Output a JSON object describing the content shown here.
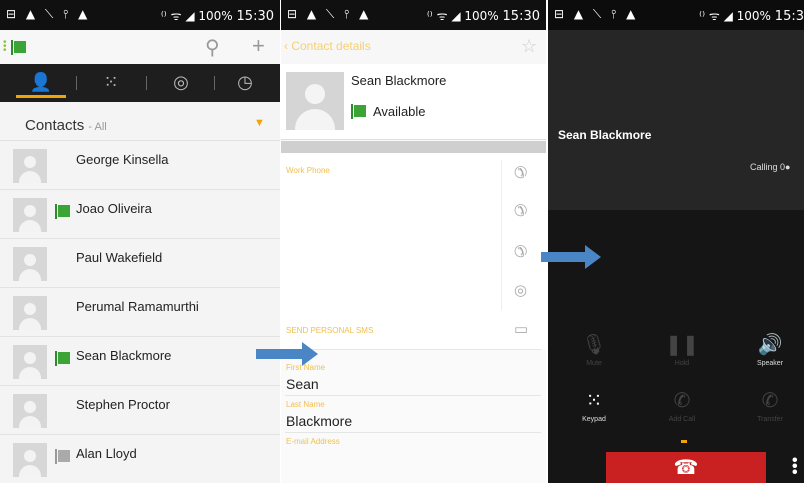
{
  "statusbars": [
    {
      "left_icons": "⊟ ▲ ⟍ ⫯ ▲",
      "right_icons": "⁽⁾ ᯤ ◢ 100%",
      "time": "15:30"
    },
    {
      "left_icons": "⊟ ▲ ⟍ ⫯ ▲",
      "right_icons": "⁽⁾ ᯤ ◢ 100%",
      "time": "15:30"
    },
    {
      "left_icons": "⊟ ▲ ⟍ ⫯ ▲",
      "right_icons": "⁽⁾ ᯤ ◢ 100%",
      "time": "15:3"
    }
  ],
  "contacts_panel": {
    "toolbar_icons": [
      "presence-flag-icon",
      "search-icon",
      "add-icon"
    ],
    "tabs": [
      {
        "name": "contacts",
        "glyph": "👤",
        "active": true
      },
      {
        "name": "dialpad",
        "glyph": "⁙",
        "active": false
      },
      {
        "name": "chat",
        "glyph": "◎",
        "active": false
      },
      {
        "name": "history",
        "glyph": "◷",
        "active": false
      }
    ],
    "title": "Contacts",
    "filter": "- All",
    "contacts": [
      {
        "name": "George Kinsella",
        "presence": "none"
      },
      {
        "name": "Joao Oliveira",
        "presence": "available"
      },
      {
        "name": "Paul Wakefield",
        "presence": "none"
      },
      {
        "name": "Perumal Ramamurthi",
        "presence": "none"
      },
      {
        "name": "Sean Blackmore",
        "presence": "available"
      },
      {
        "name": "Stephen Proctor",
        "presence": "none"
      },
      {
        "name": "Alan Lloyd",
        "presence": "offline"
      }
    ]
  },
  "details_panel": {
    "back_label": "Contact details",
    "name": "Sean Blackmore",
    "presence": "Available",
    "work_phone_label": "Work Phone",
    "sms_label": "SEND PERSONAL SMS",
    "first_name_label": "First Name",
    "first_name": "Sean",
    "last_name_label": "Last Name",
    "last_name": "Blackmore",
    "email_label": "E-mail Address"
  },
  "call_panel": {
    "name": "Sean Blackmore",
    "status": "Calling",
    "controls": [
      {
        "label": "Mute",
        "icon": "microphone-icon",
        "enabled": false
      },
      {
        "label": "Hold",
        "icon": "pause-icon",
        "enabled": false
      },
      {
        "label": "Speaker",
        "icon": "speaker-icon",
        "enabled": true
      },
      {
        "label": "Keypad",
        "icon": "keypad-icon",
        "enabled": true
      },
      {
        "label": "Add Call",
        "icon": "add-call-icon",
        "enabled": false
      },
      {
        "label": "Transfer",
        "icon": "transfer-icon",
        "enabled": false
      }
    ],
    "end_call_color": "#c92121"
  },
  "colors": {
    "accent": "#f0a30a",
    "presence_available": "#3aa436",
    "arrow": "#4a86c6"
  }
}
